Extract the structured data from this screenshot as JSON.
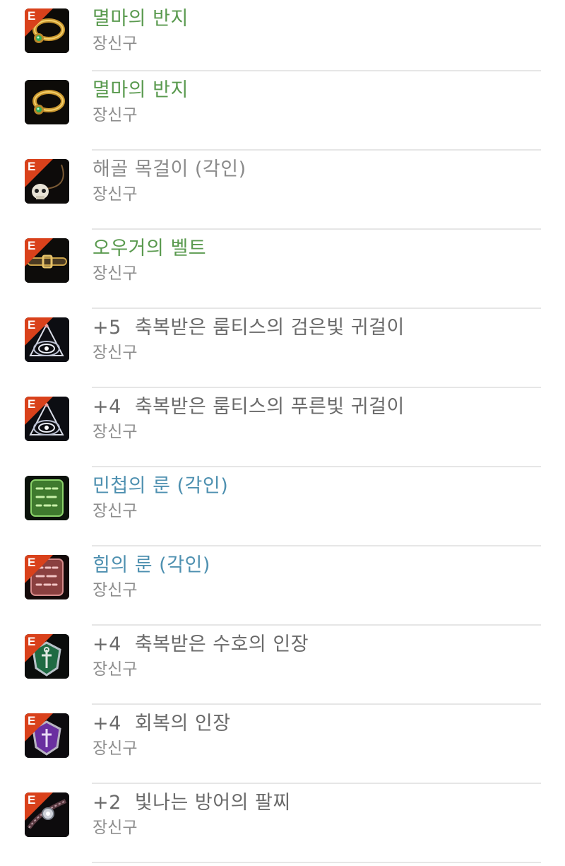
{
  "colors": {
    "green": "#5a9a4f",
    "gray": "#8a8a8a",
    "dark": "#6a6a6a",
    "blue": "#4e90b0",
    "badge": "#d9411b",
    "subtitle": "#8e8e8e"
  },
  "items": [
    {
      "badge": "E",
      "icon": "ring-icon",
      "enhance": "",
      "name": "멸마의 반지",
      "type": "장신구",
      "color": "green"
    },
    {
      "badge": "",
      "icon": "ring-icon",
      "enhance": "",
      "name": "멸마의 반지",
      "type": "장신구",
      "color": "green"
    },
    {
      "badge": "E",
      "icon": "skull-necklace-icon",
      "enhance": "",
      "name": "해골 목걸이 (각인)",
      "type": "장신구",
      "color": "gray"
    },
    {
      "badge": "E",
      "icon": "belt-icon",
      "enhance": "",
      "name": "오우거의 벨트",
      "type": "장신구",
      "color": "green"
    },
    {
      "badge": "E",
      "icon": "earring-icon",
      "enhance": "+5",
      "name": "축복받은 룸티스의 검은빛 귀걸이",
      "type": "장신구",
      "color": "dark"
    },
    {
      "badge": "E",
      "icon": "earring-icon",
      "enhance": "+4",
      "name": "축복받은 룸티스의 푸른빛 귀걸이",
      "type": "장신구",
      "color": "dark"
    },
    {
      "badge": "",
      "icon": "green-rune-icon",
      "enhance": "",
      "name": "민첩의 룬 (각인)",
      "type": "장신구",
      "color": "blue"
    },
    {
      "badge": "E",
      "icon": "red-rune-icon",
      "enhance": "",
      "name": "힘의 룬 (각인)",
      "type": "장신구",
      "color": "blue"
    },
    {
      "badge": "E",
      "icon": "green-insignia-icon",
      "enhance": "+4",
      "name": "축복받은 수호의 인장",
      "type": "장신구",
      "color": "dark"
    },
    {
      "badge": "E",
      "icon": "purple-insignia-icon",
      "enhance": "+4",
      "name": "회복의 인장",
      "type": "장신구",
      "color": "dark"
    },
    {
      "badge": "E",
      "icon": "bracelet-icon",
      "enhance": "+2",
      "name": "빛나는 방어의 팔찌",
      "type": "장신구",
      "color": "dark"
    }
  ]
}
